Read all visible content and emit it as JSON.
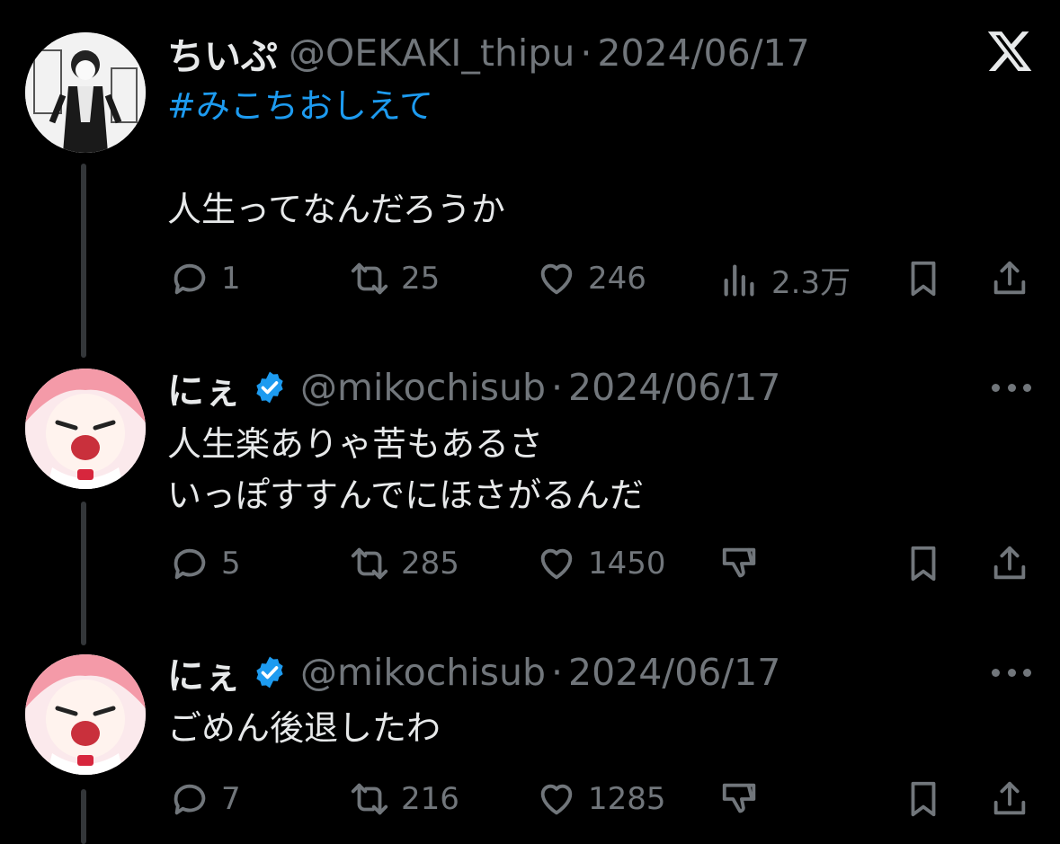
{
  "main_tweet": {
    "display_name": "ちいぷ",
    "handle": "@OEKAKI_thipu",
    "separator": "·",
    "date": "2024/06/17",
    "hashtag": "#みこちおしえて",
    "body": "人生ってなんだろうか",
    "stats": {
      "replies": "1",
      "retweets": "25",
      "likes": "246",
      "views": "2.3万"
    }
  },
  "replies": [
    {
      "display_name": "にぇ",
      "handle": "@mikochisub",
      "separator": "·",
      "date": "2024/06/17",
      "lines": [
        "人生楽ありゃ苦もあるさ",
        "いっぽすすんでにほさがるんだ"
      ],
      "stats": {
        "replies": "5",
        "retweets": "285",
        "likes": "1450"
      }
    },
    {
      "display_name": "にぇ",
      "handle": "@mikochisub",
      "separator": "·",
      "date": "2024/06/17",
      "lines": [
        "ごめん後退したわ"
      ],
      "stats": {
        "replies": "7",
        "retweets": "216",
        "likes": "1285"
      }
    }
  ],
  "icons": {
    "brand": "x-logo-icon",
    "reply": "reply-bubble-icon",
    "retweet": "retweet-icon",
    "like": "heart-icon",
    "views": "bar-chart-icon",
    "dislike": "thumbs-down-icon",
    "bookmark": "bookmark-icon",
    "share": "share-icon",
    "more": "more-dots-icon",
    "verified": "verified-badge-icon"
  },
  "colors": {
    "background": "#000000",
    "text": "#e7e9ea",
    "muted": "#71767b",
    "accent": "#1d9bf0",
    "thread_line": "#333639"
  }
}
